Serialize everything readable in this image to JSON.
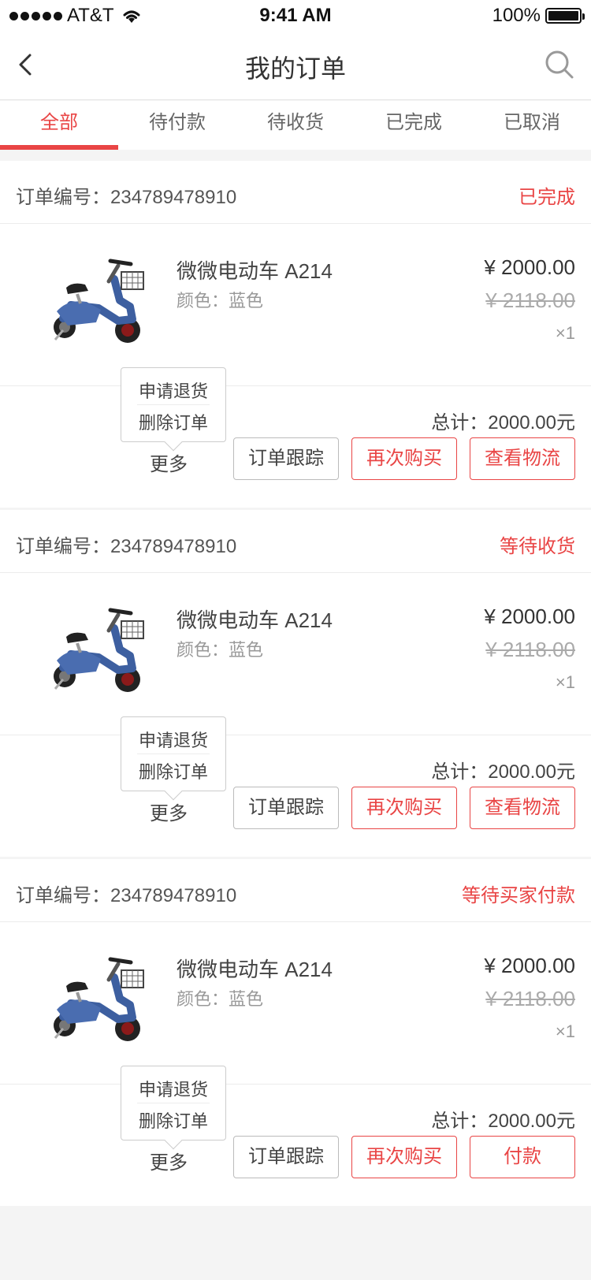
{
  "status_bar": {
    "carrier": "AT&T",
    "time": "9:41 AM",
    "battery": "100%"
  },
  "nav": {
    "title": "我的订单"
  },
  "tabs": [
    {
      "label": "全部",
      "active": true
    },
    {
      "label": "待付款",
      "active": false
    },
    {
      "label": "待收货",
      "active": false
    },
    {
      "label": "已完成",
      "active": false
    },
    {
      "label": "已取消",
      "active": false
    }
  ],
  "orders": [
    {
      "order_no": "订单编号：234789478910",
      "status": "已完成",
      "product_name": "微微电动车 A214",
      "spec": "颜色：蓝色",
      "price": "¥ 2000.00",
      "original_price": "¥ 2118.00",
      "qty": "×1",
      "total": "总计：2000.00元",
      "popup": {
        "return_label": "申请退货",
        "delete_label": "删除订单"
      },
      "more_label": "更多",
      "track_label": "订单跟踪",
      "rebuy_label": "再次购买",
      "third_label": "查看物流"
    },
    {
      "order_no": "订单编号：234789478910",
      "status": "等待收货",
      "product_name": "微微电动车 A214",
      "spec": "颜色：蓝色",
      "price": "¥ 2000.00",
      "original_price": "¥ 2118.00",
      "qty": "×1",
      "total": "总计：2000.00元",
      "popup": {
        "return_label": "申请退货",
        "delete_label": "删除订单"
      },
      "more_label": "更多",
      "track_label": "订单跟踪",
      "rebuy_label": "再次购买",
      "third_label": "查看物流"
    },
    {
      "order_no": "订单编号：234789478910",
      "status": "等待买家付款",
      "product_name": "微微电动车 A214",
      "spec": "颜色：蓝色",
      "price": "¥ 2000.00",
      "original_price": "¥ 2118.00",
      "qty": "×1",
      "total": "总计：2000.00元",
      "popup": {
        "return_label": "申请退货",
        "delete_label": "删除订单"
      },
      "more_label": "更多",
      "track_label": "订单跟踪",
      "rebuy_label": "再次购买",
      "third_label": "付款"
    }
  ],
  "colors": {
    "accent": "#e94545",
    "background": "#f4f4f4",
    "scooter_body": "#3d5fa0"
  },
  "icons": [
    "back-arrow-icon",
    "search-icon",
    "wifi-icon",
    "battery-icon",
    "scooter-image"
  ]
}
